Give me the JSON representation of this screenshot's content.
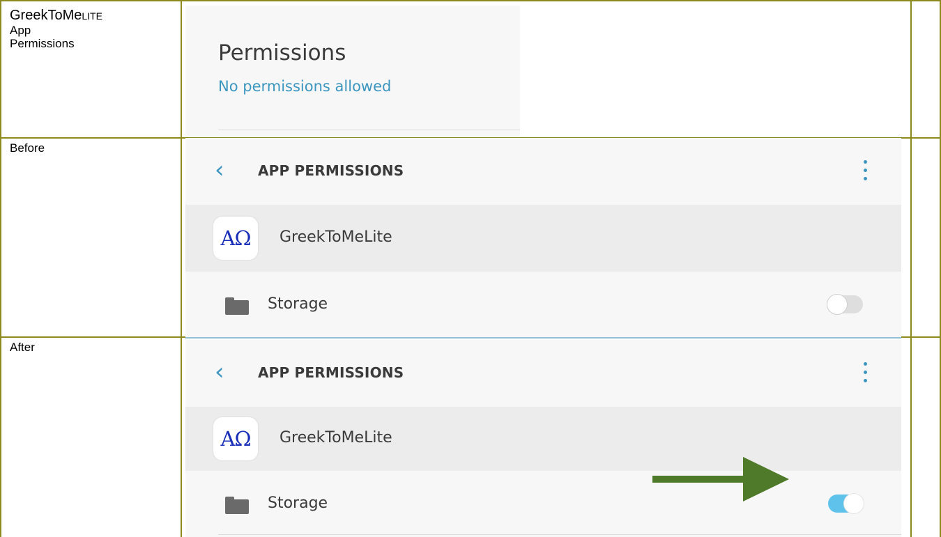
{
  "sidebar": {
    "title_main": "GreekToMe",
    "title_smallcaps": "Lite",
    "title_line2": "App",
    "title_line3": "Permissions",
    "before_label": "Before",
    "after_label": "After"
  },
  "permissions_panel": {
    "heading": "Permissions",
    "status": "No permissions allowed"
  },
  "before_screen": {
    "back_icon": "chevron-left-icon",
    "title": "APP PERMISSIONS",
    "app_name": "GreekToMeLite",
    "app_icon_text": "AΩ",
    "permission_label": "Storage",
    "toggle_state": "off"
  },
  "after_screen": {
    "back_icon": "chevron-left-icon",
    "title": "APP PERMISSIONS",
    "app_name": "GreekToMeLite",
    "app_icon_text": "AΩ",
    "permission_label": "Storage",
    "toggle_state": "on"
  },
  "colors": {
    "table_border": "#8c8a1e",
    "accent_blue": "#3d96bf",
    "toggle_on": "#5ec2ea",
    "arrow_green": "#4f7a2a"
  }
}
